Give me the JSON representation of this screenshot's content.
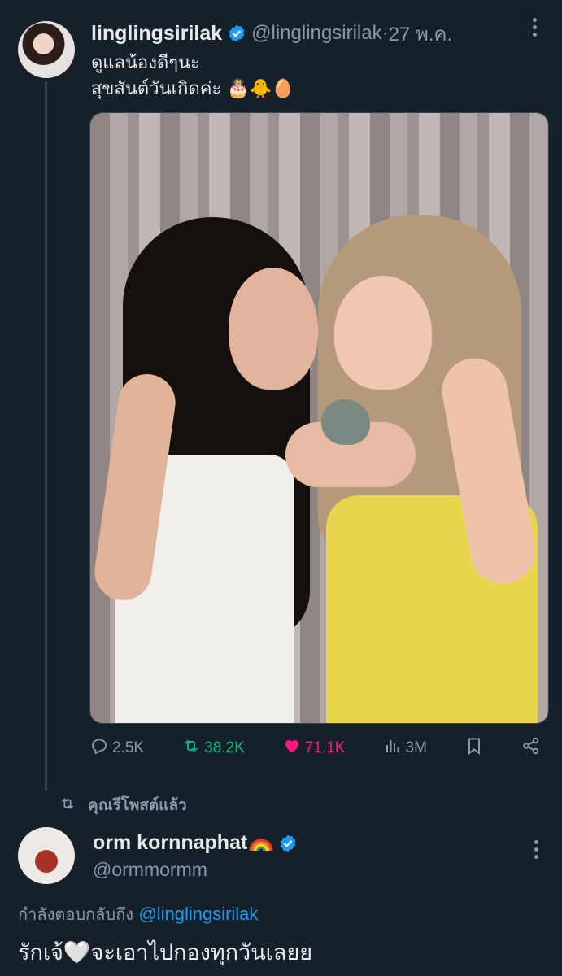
{
  "original_tweet": {
    "display_name": "linglingsirilak",
    "handle": "@linglingsirilak",
    "separator": " · ",
    "date": "27 พ.ค.",
    "text_line1": "ดูแลน้องดีๆนะ",
    "text_line2": "สุขสันต์วันเกิดค่ะ 🎂🐥🥚",
    "photo_alt": "Two women holding a small green parrot in front of a grey curtain",
    "actions": {
      "replies": "2.5K",
      "reposts": "38.2K",
      "likes": "71.1K",
      "views": "3M"
    }
  },
  "repost_note": "คุณรีโพสต์แล้ว",
  "reply_tweet": {
    "display_name": "orm kornnaphat",
    "handle": "@ormmormm",
    "replying_to_label": "กำลังตอบกลับถึง ",
    "replying_to_handle": "@linglingsirilak",
    "text": "รักเจ้🤍จะเอาไปกองทุกวันเลยย"
  },
  "colors": {
    "background": "#15202b",
    "text": "#e7e9ea",
    "muted": "#8b98a5",
    "accent_blue": "#1d9bf0",
    "repost_green": "#00ba7c",
    "like_pink": "#f91880"
  },
  "icons": [
    "verified-badge-icon",
    "more-icon",
    "reply-icon",
    "repost-icon",
    "like-icon",
    "views-icon",
    "bookmark-icon",
    "share-icon",
    "rainbow-icon"
  ]
}
